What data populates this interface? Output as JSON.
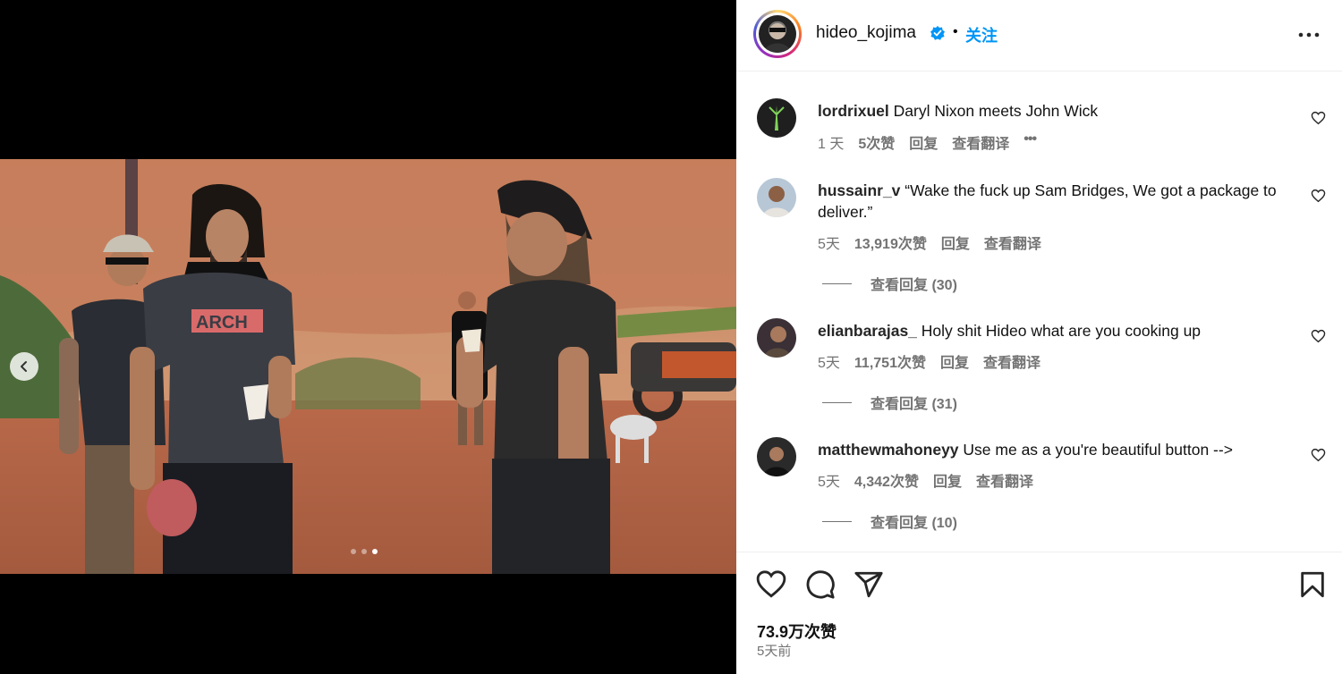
{
  "post": {
    "owner": "hideo_kojima",
    "follow_label": "关注",
    "separator": "•",
    "likes": "73.9万次赞",
    "time": "5天前",
    "carousel": {
      "count": 3,
      "active": 3
    }
  },
  "comments": [
    {
      "user": "lordrixuel",
      "text": "Daryl Nixon meets John Wick",
      "time": "1 天",
      "likes": "5次赞",
      "reply": "回复",
      "translate": "查看翻译",
      "more": "•••",
      "replies": null
    },
    {
      "user": "hussainr_v",
      "text": "“Wake the fuck up Sam Bridges, We got a package to deliver.”",
      "time": "5天",
      "likes": "13,919次赞",
      "reply": "回复",
      "translate": "查看翻译",
      "replies": "查看回复 (30)"
    },
    {
      "user": "elianbarajas_",
      "text": "Holy shit Hideo what are you cooking up",
      "time": "5天",
      "likes": "11,751次赞",
      "reply": "回复",
      "translate": "查看翻译",
      "replies": "查看回复 (31)"
    },
    {
      "user": "matthewmahoneyy",
      "text": "Use me as a you're beautiful button -->",
      "time": "5天",
      "likes": "4,342次赞",
      "reply": "回复",
      "translate": "查看翻译",
      "replies": "查看回复 (10)"
    }
  ],
  "photo": {
    "shirt_text": "ARCH"
  },
  "colors": {
    "accent": "#0095f6",
    "muted": "#737373",
    "verified": "#0095f6"
  },
  "icons": [
    "chevron-left-icon",
    "verified-badge-icon",
    "more-horizontal-icon",
    "heart-icon",
    "comment-icon",
    "share-icon",
    "bookmark-icon"
  ]
}
